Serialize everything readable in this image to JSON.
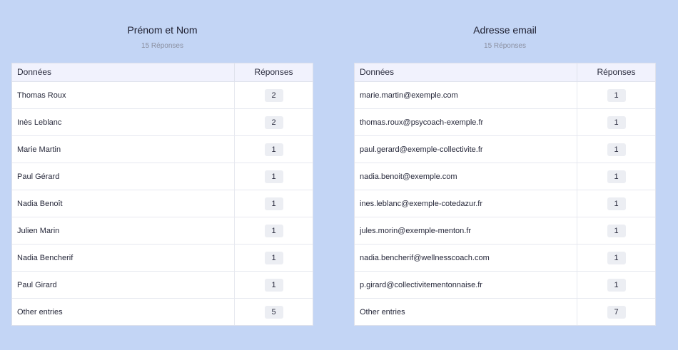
{
  "panels": [
    {
      "title": "Prénom et Nom",
      "subtitle": "15 Réponses",
      "header_data": "Données",
      "header_count": "Réponses",
      "rows": [
        {
          "label": "Thomas Roux",
          "count": "2"
        },
        {
          "label": "Inès Leblanc",
          "count": "2"
        },
        {
          "label": "Marie Martin",
          "count": "1"
        },
        {
          "label": "Paul Gérard",
          "count": "1"
        },
        {
          "label": "Nadia Benoît",
          "count": "1"
        },
        {
          "label": "Julien Marin",
          "count": "1"
        },
        {
          "label": "Nadia Bencherif",
          "count": "1"
        },
        {
          "label": "Paul Girard",
          "count": "1"
        },
        {
          "label": "Other entries",
          "count": "5"
        }
      ]
    },
    {
      "title": "Adresse email",
      "subtitle": "15 Réponses",
      "header_data": "Données",
      "header_count": "Réponses",
      "rows": [
        {
          "label": "marie.martin@exemple.com",
          "count": "1"
        },
        {
          "label": "thomas.roux@psycoach-exemple.fr",
          "count": "1"
        },
        {
          "label": "paul.gerard@exemple-collectivite.fr",
          "count": "1"
        },
        {
          "label": "nadia.benoit@exemple.com",
          "count": "1"
        },
        {
          "label": "ines.leblanc@exemple-cotedazur.fr",
          "count": "1"
        },
        {
          "label": "jules.morin@exemple-menton.fr",
          "count": "1"
        },
        {
          "label": "nadia.bencherif@wellnesscoach.com",
          "count": "1"
        },
        {
          "label": "p.girard@collectivitementonnaise.fr",
          "count": "1"
        },
        {
          "label": "Other entries",
          "count": "7"
        }
      ]
    }
  ],
  "colors": {
    "background": "#c3d5f5",
    "table_header": "#f1f2fd",
    "badge": "#eceef3"
  }
}
